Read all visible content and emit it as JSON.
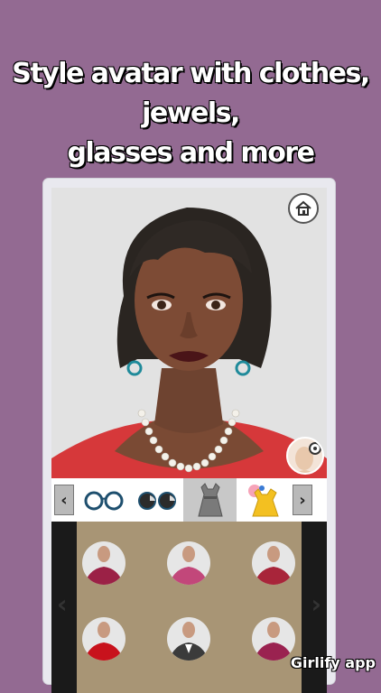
{
  "theme": {
    "background": "#936a92"
  },
  "headline": {
    "line1": "Style avatar with clothes, jewels,",
    "line2": "glasses and more"
  },
  "avatar": {
    "home_icon": "home-icon",
    "settings_icon": "gear-icon"
  },
  "toolbar": {
    "left_arrow": "‹",
    "right_arrow": "›",
    "categories": [
      {
        "name": "glasses",
        "icon": "round-glasses-icon"
      },
      {
        "name": "sunglasses",
        "icon": "sunglasses-icon"
      },
      {
        "name": "dress",
        "icon": "dress-icon",
        "selected": true
      },
      {
        "name": "outfits",
        "icon": "outfit-icon"
      }
    ]
  },
  "clothes_grid": {
    "items": [
      {
        "color": "#9b2146"
      },
      {
        "color": "#c2477a"
      },
      {
        "color": "#a8253a"
      },
      {
        "color": "#c8121c"
      },
      {
        "color": "#3b3b3b"
      },
      {
        "color": "#9a2250"
      }
    ]
  },
  "watermark": "Girlify app"
}
